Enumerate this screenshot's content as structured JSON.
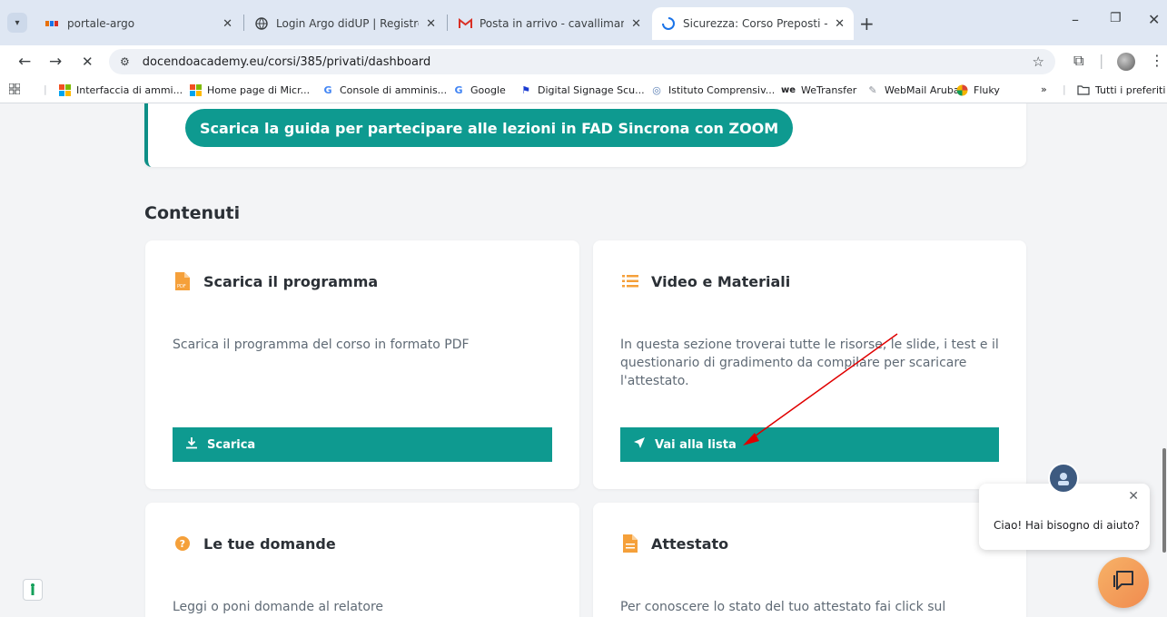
{
  "browser": {
    "tabs": [
      {
        "label": "portale-argo",
        "close": "✕",
        "active": false
      },
      {
        "label": "Login Argo didUP | Registro Ele",
        "close": "✕",
        "active": false
      },
      {
        "label": "Posta in arrivo - cavallimanuela",
        "close": "✕",
        "active": false
      },
      {
        "label": "Sicurezza: Corso Preposti - Prin",
        "close": "✕",
        "active": true
      }
    ],
    "new_tab": "+",
    "window_controls": {
      "minimize": "–",
      "restore": "❐",
      "close": "✕"
    },
    "url": "docendoacademy.eu/corsi/385/privati/dashboard",
    "nav": {
      "back": "←",
      "forward": "→",
      "stop": "✕"
    },
    "bookmarks": [
      {
        "label": "Interfaccia di ammi...",
        "icon": "microsoft-icon"
      },
      {
        "label": "Home page di Micr...",
        "icon": "microsoft-icon"
      },
      {
        "label": "Console di amminis...",
        "icon": "google-icon"
      },
      {
        "label": "Google",
        "icon": "google-icon"
      },
      {
        "label": "Digital Signage Scu...",
        "icon": "flag-icon"
      },
      {
        "label": "Istituto Comprensiv...",
        "icon": "school-icon"
      },
      {
        "label": "WeTransfer",
        "icon": "wetransfer-icon"
      },
      {
        "label": "WebMail Aruba",
        "icon": "aruba-icon"
      },
      {
        "label": "Fluky",
        "icon": "fluky-icon"
      }
    ],
    "bookmarks_overflow": "»",
    "all_bookmarks": "Tutti i preferiti"
  },
  "page": {
    "zoom_guide_button": "Scarica la guida per partecipare alle lezioni in FAD Sincrona con ZOOM",
    "section_title": "Contenuti",
    "cards": [
      {
        "title": "Scarica il programma",
        "icon": "pdf-file-icon",
        "description": "Scarica il programma del corso in formato PDF",
        "button": "Scarica",
        "button_icon": "download-icon"
      },
      {
        "title": "Video e Materiali",
        "icon": "list-icon",
        "description": "In questa sezione troverai tutte le risorse, le slide, i test e il questionario di gradimento da compilare per scaricare l'attestato.",
        "button": "Vai alla lista",
        "button_icon": "send-icon"
      },
      {
        "title": "Le tue domande",
        "icon": "question-circle-icon",
        "description": "Leggi o poni domande al relatore"
      },
      {
        "title": "Attestato",
        "icon": "document-icon",
        "description": "Per conoscere lo stato del tuo attestato fai click sul"
      }
    ],
    "chat": {
      "message": "Ciao! Hai bisogno di aiuto?",
      "close": "✕"
    }
  },
  "colors": {
    "accent": "#0e9a90",
    "orange": "#f5a03a",
    "annotation": "#e00000"
  }
}
